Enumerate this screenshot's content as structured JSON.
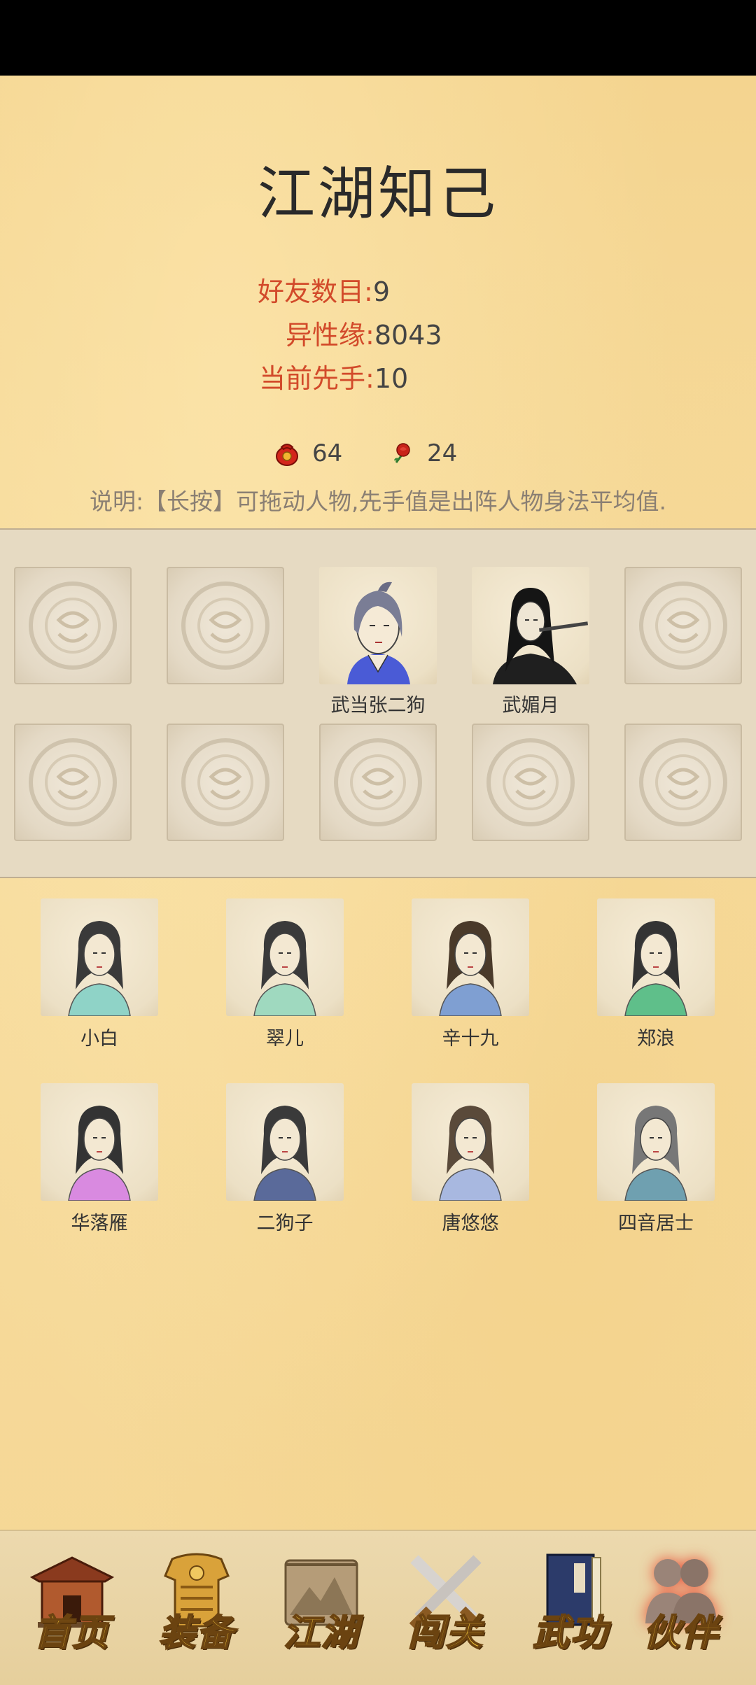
{
  "page": {
    "title": "江湖知己",
    "stats": [
      {
        "label": "好友数目:",
        "value": "9"
      },
      {
        "label": "异性缘:",
        "value": "8043"
      },
      {
        "label": "当前先手:",
        "value": "10"
      }
    ],
    "currencies": [
      {
        "icon": "red-pouch-icon",
        "value": "64"
      },
      {
        "icon": "rose-icon",
        "value": "24"
      }
    ],
    "note": "说明:【长按】可拖动人物,先手值是出阵人物身法平均值."
  },
  "formation": {
    "row1": [
      {
        "name": "",
        "filled": false
      },
      {
        "name": "",
        "filled": false
      },
      {
        "name": "武当张二狗",
        "filled": true
      },
      {
        "name": "武媚月",
        "filled": true
      },
      {
        "name": "",
        "filled": false
      }
    ],
    "row2": [
      {
        "name": "",
        "filled": false
      },
      {
        "name": "",
        "filled": false
      },
      {
        "name": "",
        "filled": false
      },
      {
        "name": "",
        "filled": false
      },
      {
        "name": "",
        "filled": false
      }
    ]
  },
  "partners": [
    {
      "name": "小白",
      "shirt": "#8fd3c7",
      "hair": "#3a3a3a"
    },
    {
      "name": "翠儿",
      "shirt": "#9fd9bf",
      "hair": "#3a3a3a"
    },
    {
      "name": "辛十九",
      "shirt": "#7f9fd2",
      "hair": "#4a3a2a"
    },
    {
      "name": "郑浪",
      "shirt": "#5fbf8a",
      "hair": "#333333"
    },
    {
      "name": "华落雁",
      "shirt": "#d98ae0",
      "hair": "#333333"
    },
    {
      "name": "二狗子",
      "shirt": "#5a6a9a",
      "hair": "#3a3a3a"
    },
    {
      "name": "唐悠悠",
      "shirt": "#a8b8e0",
      "hair": "#5a4a3a"
    },
    {
      "name": "四音居士",
      "shirt": "#6fa0b0",
      "hair": "#777777"
    }
  ],
  "nav": [
    {
      "label": "首页",
      "icon": "house-icon",
      "active": false
    },
    {
      "label": "装备",
      "icon": "armor-icon",
      "active": false
    },
    {
      "label": "江湖",
      "icon": "map-scroll-icon",
      "active": false
    },
    {
      "label": "闯关",
      "icon": "crossed-swords-icon",
      "active": false
    },
    {
      "label": "武功",
      "icon": "book-icon",
      "active": false
    },
    {
      "label": "伙伴",
      "icon": "partners-icon",
      "active": true
    }
  ],
  "colors": {
    "accent_red": "#d24a2a",
    "nav_gold": "#f2c53a"
  }
}
